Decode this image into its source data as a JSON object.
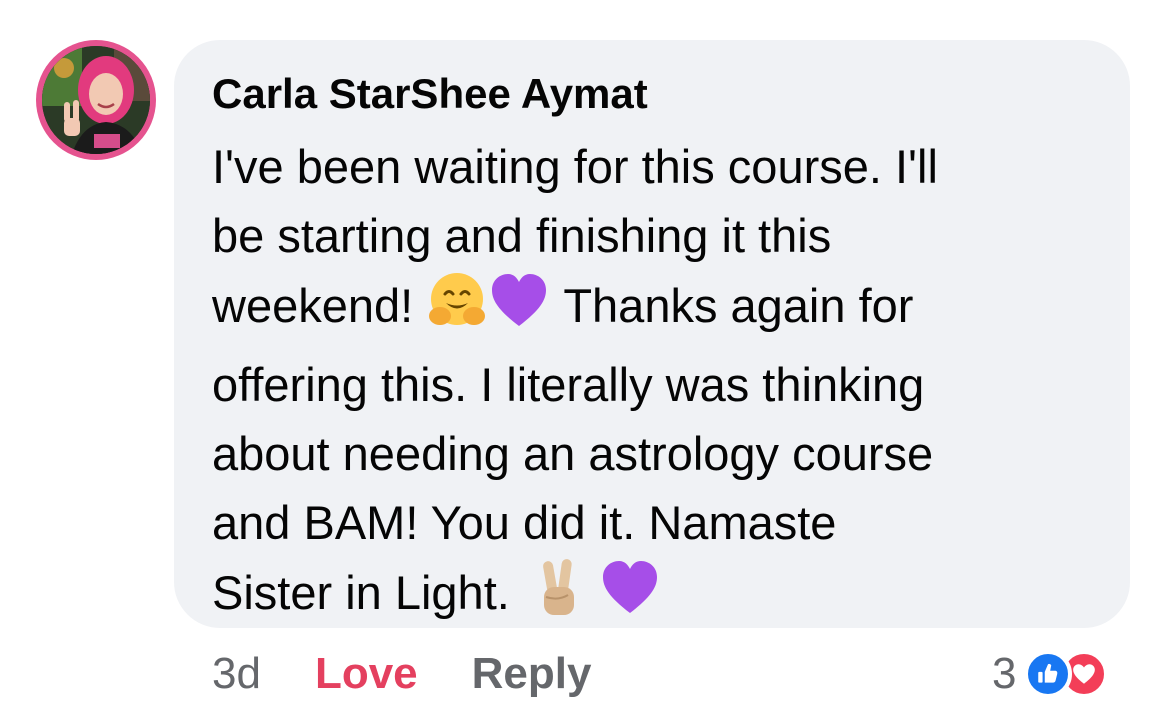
{
  "comment": {
    "author": "Carla StarShee Aymat",
    "body_lines": [
      "I've been waiting for this course. I'll",
      "be starting and finishing it this",
      "weekend!",
      "Thanks again for",
      "offering this. I literally was thinking",
      "about needing an astrology course",
      "and BAM! You did it. Namaste",
      "Sister in Light."
    ],
    "emojis": [
      "hugging-face",
      "purple-heart",
      "victory-hand",
      "purple-heart"
    ]
  },
  "actions": {
    "timestamp": "3d",
    "love": "Love",
    "reply": "Reply"
  },
  "reactions": {
    "count": "3",
    "types": [
      "like",
      "love"
    ]
  },
  "colors": {
    "bubble": "#f0f2f5",
    "love_action": "#e4405f",
    "like_blue": "#1877f2",
    "love_red": "#f33e58",
    "secondary_text": "#65676b"
  }
}
